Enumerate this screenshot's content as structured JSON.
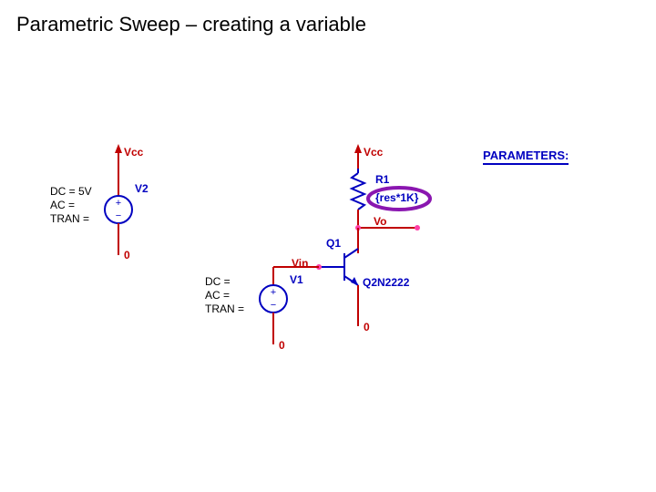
{
  "title": "Parametric Sweep – creating a variable",
  "labels": {
    "vcc1": "Vcc",
    "vcc2": "Vcc",
    "v2": "V2",
    "v1": "V1",
    "vin": "Vin",
    "vo": "Vo",
    "r1": "R1",
    "r1_value": "{res*1K}",
    "q1": "Q1",
    "q2n2222": "Q2N2222",
    "zero1": "0",
    "zero2": "0",
    "zero3": "0",
    "parameters": "PARAMETERS:",
    "src1_dc": "DC = 5V",
    "src1_ac": "AC =",
    "src1_tran": "TRAN =",
    "src2_dc": "DC =",
    "src2_ac": "AC =",
    "src2_tran": "TRAN ="
  },
  "colors": {
    "wire": "#c00000",
    "device": "#0000c0",
    "annot": "#8a16b0",
    "node": "#ff3fa7"
  }
}
